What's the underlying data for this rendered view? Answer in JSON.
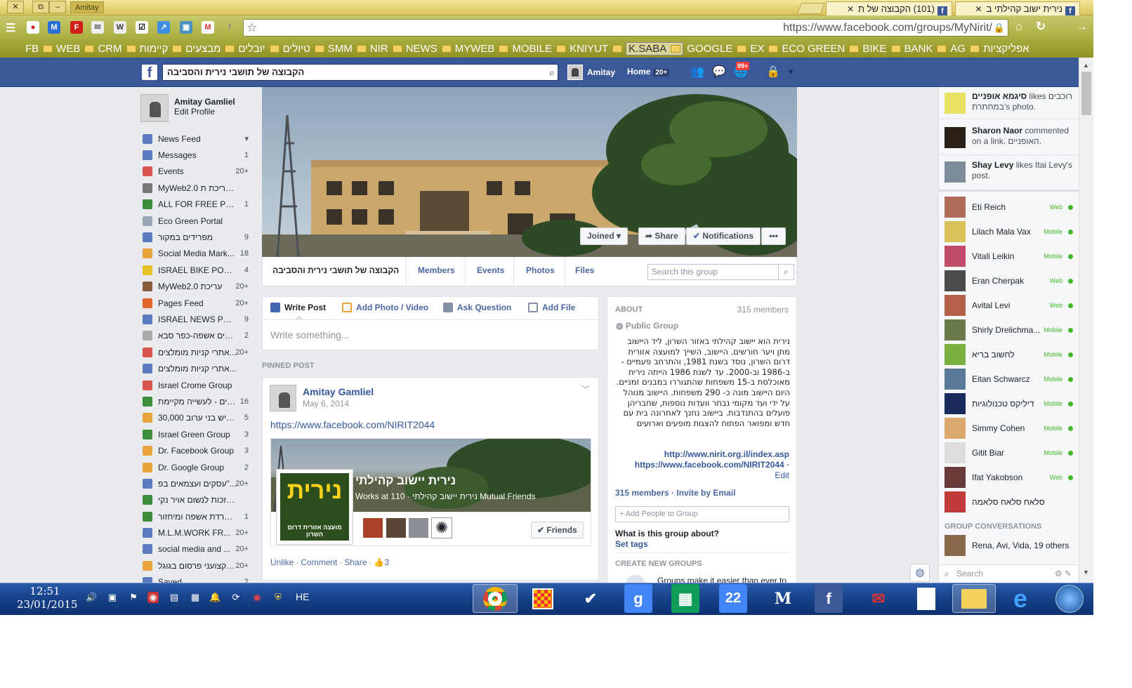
{
  "window": {
    "profile_name": "Amitay",
    "close": "✕",
    "restore": "⧉",
    "minimize": "–"
  },
  "tabs": [
    {
      "title": "נירית ישוב קהילתי ב",
      "close": "✕"
    },
    {
      "title": "(101) הקבוצה של ת",
      "close": "✕"
    }
  ],
  "address_bar": {
    "url": "https://www.facebook.com/groups/MyNirit/"
  },
  "bookmarks": [
    "FB",
    "WEB",
    "CRM",
    "קיימות",
    "מבצעים",
    "יובלים",
    "טיולים",
    "SMM",
    "NIR",
    "NEWS",
    "MYWEB",
    "MOBILE",
    "KNIYUT",
    "K.SABA",
    "GOOGLE",
    "EX",
    "ECO GREEN",
    "BIKE",
    "BANK",
    "AG",
    "אפליקציות"
  ],
  "fb_header": {
    "logo": "f",
    "search_value": "הקבוצה של תושבי נירית והסביבה",
    "user": "Amitay",
    "home": "Home",
    "home_count": "20+",
    "notif_count": "99+"
  },
  "left_nav": {
    "name": "Amitay Gamliel",
    "edit": "Edit Profile",
    "items": [
      {
        "label": "News Feed",
        "count": "▾",
        "color": "#5b7bc0"
      },
      {
        "label": "Messages",
        "count": "1",
        "color": "#5b7bc0"
      },
      {
        "label": "Events",
        "count": "20+",
        "color": "#d9534f"
      },
      {
        "label": "MyWeb2.0 עריכת ת...",
        "count": "",
        "color": "#777"
      },
      {
        "label": "ALL FOR FREE PO...",
        "count": "1",
        "color": "#3c8d3c"
      },
      {
        "label": "Eco Green Portal",
        "count": "",
        "color": "#9aa6b8"
      },
      {
        "label": "מפרידים במקור",
        "count": "9",
        "color": "#5b7bc0"
      },
      {
        "label": "Social Media Mark...",
        "count": "18",
        "color": "#e8a33a"
      },
      {
        "label": "ISRAEL BIKE POR...",
        "count": "4",
        "color": "#e6c229"
      },
      {
        "label": "MyWeb2.0 עריכת",
        "count": "20+",
        "color": "#8a5a3c"
      },
      {
        "label": "Pages Feed",
        "count": "20+",
        "color": "#e0662d"
      },
      {
        "label": "ISRAEL NEWS PO...",
        "count": "9",
        "color": "#5b7bc0"
      },
      {
        "label": "מפרידים אשפה-כפר סבא",
        "count": "2",
        "color": "#aaa"
      },
      {
        "label": "אתרי קניות מומלצים...",
        "count": "20+",
        "color": "#d9534f"
      },
      {
        "label": "אתרי קניות מומלצים...",
        "count": "",
        "color": "#5b7bc0"
      },
      {
        "label": "Israel Crome Group",
        "count": "",
        "color": "#d9534f"
      },
      {
        "label": "בלוטים - לעשייה מקיימת",
        "count": "16",
        "color": "#3c8d3c"
      },
      {
        "label": "30,000 איש בני ערוב...",
        "count": "5",
        "color": "#e8a33a"
      },
      {
        "label": "Israel Green Group",
        "count": "3",
        "color": "#3c8d3c"
      },
      {
        "label": "Dr. Facebook Group",
        "count": "3",
        "color": "#e8a33a"
      },
      {
        "label": "Dr. Google Group",
        "count": "2",
        "color": "#e8a33a"
      },
      {
        "label": "עסקים ועצמאים בפ\"...",
        "count": "20+",
        "color": "#5b7bc0"
      },
      {
        "label": "הזכות לנשום אויר נקי...",
        "count": "",
        "color": "#3c8d3c"
      },
      {
        "label": "הפרדת אשפה ומיחזור...",
        "count": "1",
        "color": "#3c8d3c"
      },
      {
        "label": "M.L.M.WORK FR...",
        "count": "20+",
        "color": "#5b7bc0"
      },
      {
        "label": "social media and ...",
        "count": "20+",
        "color": "#5b7bc0"
      },
      {
        "label": "מקצועני פרסום בגוגל...",
        "count": "20+",
        "color": "#e8a33a"
      },
      {
        "label": "Saved",
        "count": "2",
        "color": "#5b7bc0"
      }
    ]
  },
  "cover": {
    "joined": "Joined ▾",
    "share": "Share",
    "notifications": "Notifications",
    "more": "•••"
  },
  "group_nav": {
    "name": "הקבוצה של תושבי נירית והסביבה",
    "members": "Members",
    "events": "Events",
    "photos": "Photos",
    "files": "Files",
    "search_placeholder": "Search this group"
  },
  "composer": {
    "write_post": "Write Post",
    "add_photo": "Add Photo / Video",
    "ask": "Ask Question",
    "add_file": "Add File",
    "placeholder": "Write something..."
  },
  "pinned_label": "PINNED POST",
  "post": {
    "author": "Amitay Gamliel",
    "date": "May 6, 2014",
    "link": "https://www.facebook.com/NIRIT2044",
    "preview_title": "נירית יישוב קהילתי",
    "preview_sub": "Works at נירית יישוב קהילתי · 110 Mutual Friends",
    "thumb_text": "נירית",
    "thumb_sub": "מועצה אזורית דרום השרון",
    "friends_btn": "✔ Friends",
    "unlike": "Unlike",
    "comment": "Comment",
    "share": "Share",
    "likes": "3"
  },
  "about": {
    "heading": "ABOUT",
    "members_count": "315 members",
    "privacy": "Public Group",
    "description": "נירית הוא יישוב קהילתי באזור השרון, ליד היישוב מתן ויער חורשים. היישוב, השייך למועצה אזורית דרום השרון, נוסד בשנת 1981, והתרחב פעמיים - ב-1986 וב-2000. עד לשנת 1986 הייתה נירית מאוכלסת ב-15 משפחות שהתגוררו במבנים זמניים. היום היישוב מונה כ- 290 משפחות. היישוב מנוהל על ידי ועד מקומי נבחר וועדות נוספות, שחבריהן פועלים בהתנדבות. ביישוב נחנך לאחרונה בית עם חדש ומפואר הפתוח להצגות מופעים וארועים",
    "link1": "http://www.nirit.org.il/index.asp",
    "link2": "https://www.facebook.com/NIRIT2044 ·",
    "edit": "Edit",
    "members_line": "315 members · Invite by Email",
    "add_people": "+ Add People to Group",
    "question": "What is this group about?",
    "set_tags": "Set tags",
    "create_heading": "CREATE NEW GROUPS",
    "create_text": "Groups make it easier than ever to"
  },
  "ticker": [
    {
      "name": "סיגמא אופניים",
      "text": "likes רוכבים במחתרת's photo."
    },
    {
      "name": "Sharon Naor",
      "text": "commented on a link. האופניים."
    },
    {
      "name": "Shay Levy",
      "text": "likes Itai Levy's post."
    }
  ],
  "contacts": [
    {
      "name": "Eti Reich",
      "status": "Web",
      "color": "#b06a5a"
    },
    {
      "name": "Lilach Mala Vax",
      "status": "Mobile",
      "color": "#d9c25a"
    },
    {
      "name": "Vitali Leikin",
      "status": "Mobile",
      "color": "#c24a6a"
    },
    {
      "name": "Eran Cherpak",
      "status": "Web",
      "color": "#4a4a4a"
    },
    {
      "name": "Avital Levi",
      "status": "Web",
      "color": "#b5604a"
    },
    {
      "name": "Shirly Drelichma...",
      "status": "Mobile",
      "color": "#6a7a4a"
    },
    {
      "name": "לחשוב בריא",
      "status": "Mobile",
      "color": "#7ab040"
    },
    {
      "name": "Eitan Schwarcz",
      "status": "Mobile",
      "color": "#5a7a9a"
    },
    {
      "name": "דיליקס טכנולוגיות",
      "status": "Mobile",
      "color": "#1a2a5a"
    },
    {
      "name": "Simmy Cohen",
      "status": "Mobile",
      "color": "#d9a86a"
    },
    {
      "name": "Gitit Biar",
      "status": "Mobile",
      "color": "#ddd"
    },
    {
      "name": "Ifat Yakobson",
      "status": "Web",
      "color": "#6a3a3a"
    },
    {
      "name": "סלאח סלאח סלאמה",
      "status": "",
      "color": "#c03a3a"
    }
  ],
  "group_conversations": {
    "heading": "GROUP CONVERSATIONS",
    "item": "Rena, Avi, Vida, 19 others"
  },
  "chat_search": "Search",
  "taskbar": {
    "time": "12:51",
    "date": "23/01/2015",
    "lang": "HE"
  }
}
